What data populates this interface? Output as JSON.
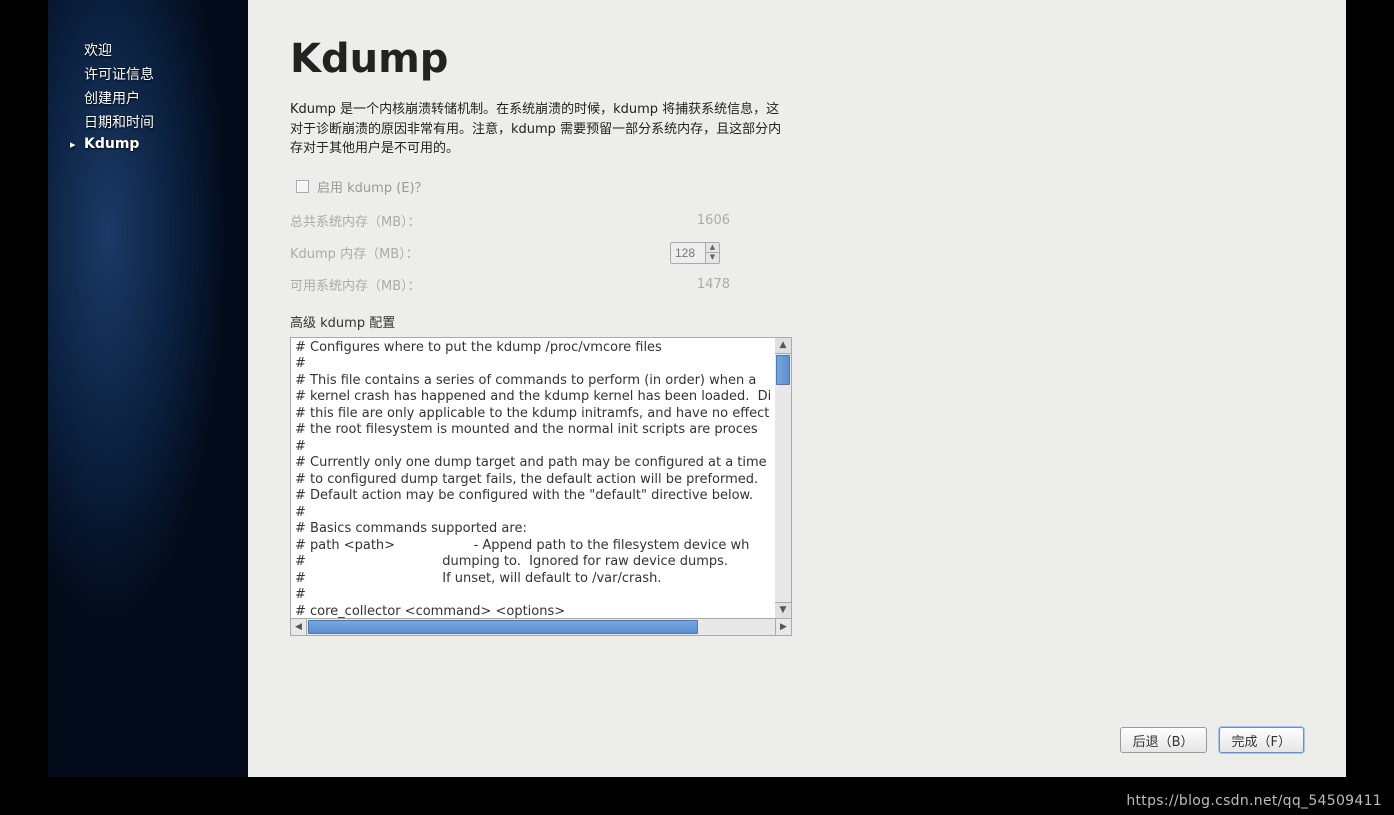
{
  "sidebar": {
    "items": [
      {
        "label": "欢迎",
        "active": false
      },
      {
        "label": "许可证信息",
        "active": false
      },
      {
        "label": "创建用户",
        "active": false
      },
      {
        "label": "日期和时间",
        "active": false
      },
      {
        "label": "Kdump",
        "active": true
      }
    ]
  },
  "page": {
    "title": "Kdump",
    "description": "Kdump 是一个内核崩溃转储机制。在系统崩溃的时候，kdump 将捕获系统信息，这对于诊断崩溃的原因非常有用。注意，kdump 需要预留一部分系统内存，且这部分内存对于其他用户是不可用的。",
    "enable_label": "启用 kdump (E)？",
    "enable_checked": false,
    "total_mem_label": "总共系统内存（MB）：",
    "total_mem_value": "1606",
    "kdump_mem_label": "Kdump 内存（MB）：",
    "kdump_mem_value": "128",
    "avail_mem_label": "可用系统内存（MB）：",
    "avail_mem_value": "1478",
    "advanced_label": "高级 kdump 配置",
    "config_text": "# Configures where to put the kdump /proc/vmcore files\n#\n# This file contains a series of commands to perform (in order) when a\n# kernel crash has happened and the kdump kernel has been loaded.  Di\n# this file are only applicable to the kdump initramfs, and have no effect\n# the root filesystem is mounted and the normal init scripts are proces\n#\n# Currently only one dump target and path may be configured at a time\n# to configured dump target fails, the default action will be preformed.\n# Default action may be configured with the \"default\" directive below.\n#\n# Basics commands supported are:\n# path <path>                   - Append path to the filesystem device wh\n#                                 dumping to.  Ignored for raw device dumps.\n#                                 If unset, will default to /var/crash.\n#\n# core_collector <command> <options>"
  },
  "buttons": {
    "back": "后退（B）",
    "finish": "完成（F）"
  },
  "watermark": "https://blog.csdn.net/qq_54509411"
}
